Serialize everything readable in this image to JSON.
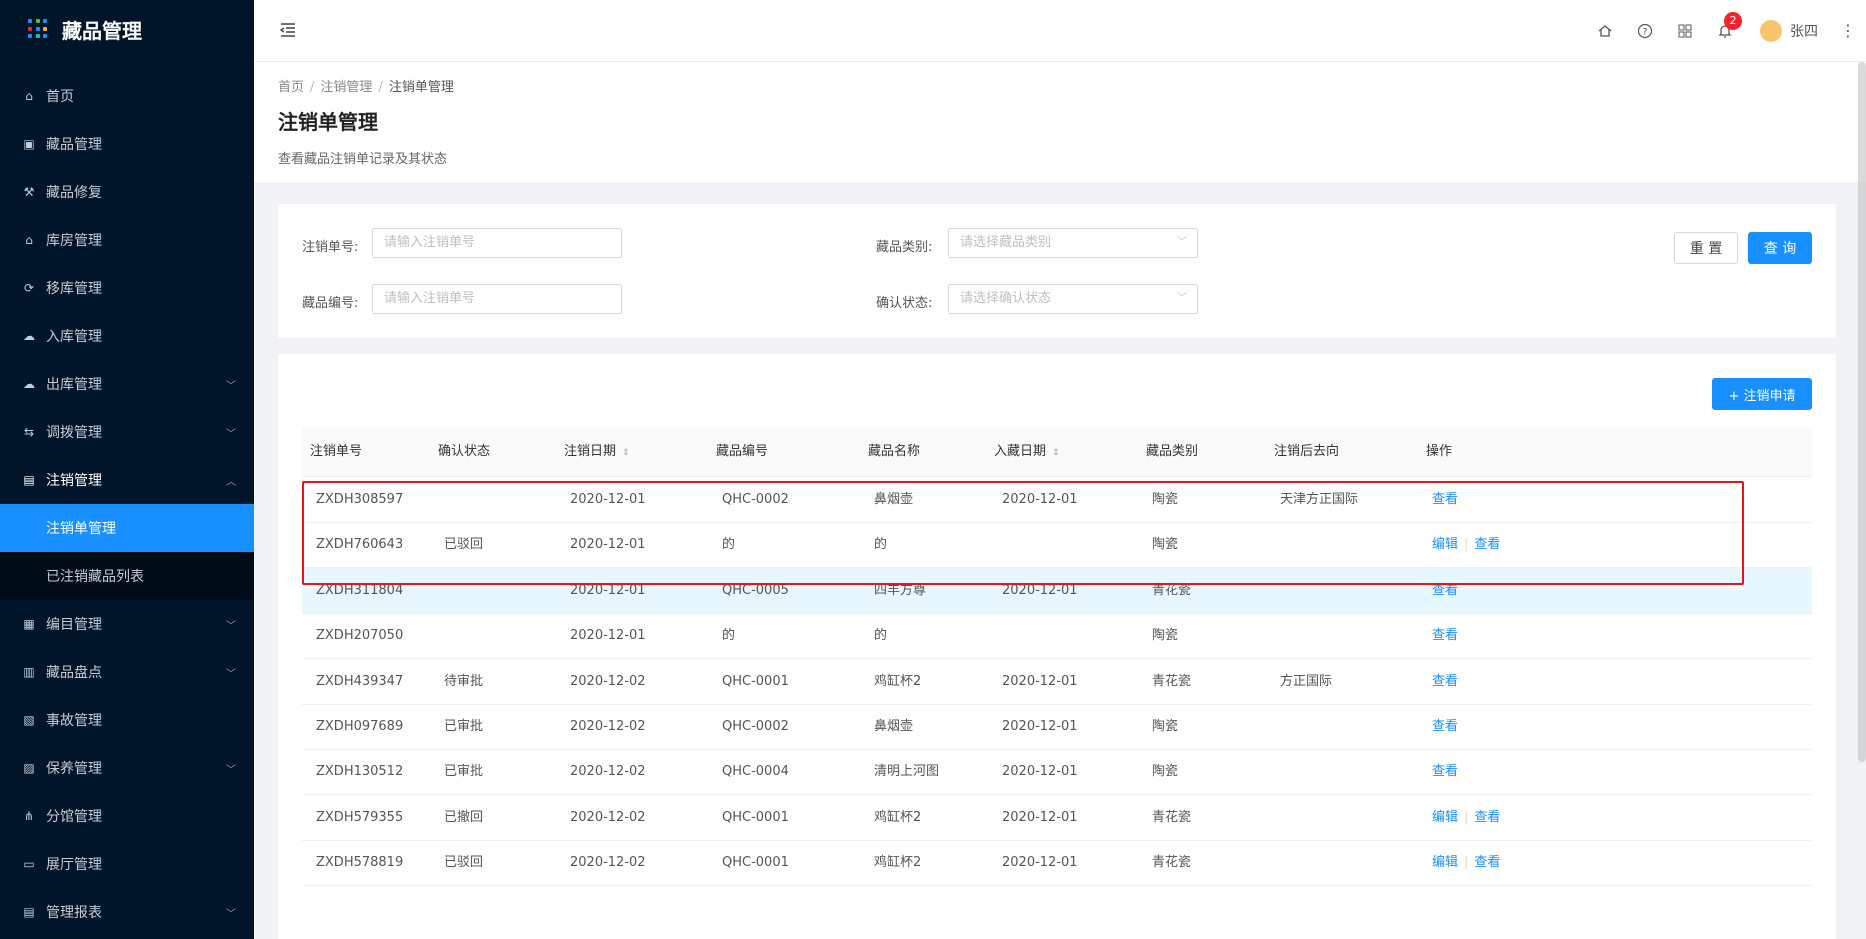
{
  "app": {
    "title": "藏品管理"
  },
  "sidebar": {
    "items": [
      {
        "label": "首页",
        "icon": "home-icon"
      },
      {
        "label": "藏品管理",
        "icon": "calendar-icon"
      },
      {
        "label": "藏品修复",
        "icon": "wrench-icon"
      },
      {
        "label": "库房管理",
        "icon": "warehouse-icon"
      },
      {
        "label": "移库管理",
        "icon": "move-icon"
      },
      {
        "label": "入库管理",
        "icon": "cloud-upload-icon"
      },
      {
        "label": "出库管理",
        "icon": "cloud-download-icon",
        "expandable": true
      },
      {
        "label": "调拨管理",
        "icon": "transfer-icon",
        "expandable": true
      },
      {
        "label": "注销管理",
        "icon": "document-icon",
        "expandable": true,
        "open": true
      },
      {
        "label": "编目管理",
        "icon": "catalog-icon",
        "expandable": true
      },
      {
        "label": "藏品盘点",
        "icon": "inventory-icon",
        "expandable": true
      },
      {
        "label": "事故管理",
        "icon": "incident-icon"
      },
      {
        "label": "保养管理",
        "icon": "maintenance-icon",
        "expandable": true
      },
      {
        "label": "分馆管理",
        "icon": "branch-icon"
      },
      {
        "label": "展厅管理",
        "icon": "hall-icon"
      },
      {
        "label": "管理报表",
        "icon": "report-icon",
        "expandable": true
      }
    ],
    "submenu": [
      {
        "label": "注销单管理",
        "active": true
      },
      {
        "label": "已注销藏品列表",
        "active": false
      }
    ]
  },
  "topbar": {
    "notification_count": "2",
    "user_name": "张四"
  },
  "breadcrumb": [
    "首页",
    "注销管理",
    "注销单管理"
  ],
  "page": {
    "title": "注销单管理",
    "description": "查看藏品注销单记录及其状态"
  },
  "filters": {
    "order_no_label": "注销单号:",
    "order_no_placeholder": "请输入注销单号",
    "item_no_label": "藏品编号:",
    "item_no_placeholder": "请输入注销单号",
    "category_label": "藏品类别:",
    "category_placeholder": "请选择藏品类别",
    "status_label": "确认状态:",
    "status_placeholder": "请选择确认状态",
    "reset_label": "重 置",
    "search_label": "查 询"
  },
  "table": {
    "add_button": "+ 注销申请",
    "columns": [
      "注销单号",
      "确认状态",
      "注销日期",
      "藏品编号",
      "藏品名称",
      "入藏日期",
      "藏品类别",
      "注销后去向",
      "操作"
    ],
    "rows": [
      {
        "no": "ZXDH308597",
        "status": "",
        "date": "2020-12-01",
        "item_no": "QHC-0002",
        "name": "鼻烟壶",
        "in_date": "2020-12-01",
        "category": "陶瓷",
        "dest": "天津方正国际",
        "actions": [
          "查看"
        ]
      },
      {
        "no": "ZXDH760643",
        "status": "已驳回",
        "date": "2020-12-01",
        "item_no": "的",
        "name": "的",
        "in_date": "",
        "category": "陶瓷",
        "dest": "",
        "actions": [
          "编辑",
          "查看"
        ]
      },
      {
        "no": "ZXDH311804",
        "status": "",
        "date": "2020-12-01",
        "item_no": "QHC-0005",
        "name": "四羊方尊",
        "in_date": "2020-12-01",
        "category": "青花瓷",
        "dest": "",
        "actions": [
          "查看"
        ],
        "highlight": true
      },
      {
        "no": "ZXDH207050",
        "status": "",
        "date": "2020-12-01",
        "item_no": "的",
        "name": "的",
        "in_date": "",
        "category": "陶瓷",
        "dest": "",
        "actions": [
          "查看"
        ]
      },
      {
        "no": "ZXDH439347",
        "status": "待审批",
        "date": "2020-12-02",
        "item_no": "QHC-0001",
        "name": "鸡缸杯2",
        "in_date": "2020-12-01",
        "category": "青花瓷",
        "dest": "方正国际",
        "actions": [
          "查看"
        ]
      },
      {
        "no": "ZXDH097689",
        "status": "已审批",
        "date": "2020-12-02",
        "item_no": "QHC-0002",
        "name": "鼻烟壶",
        "in_date": "2020-12-01",
        "category": "陶瓷",
        "dest": "",
        "actions": [
          "查看"
        ]
      },
      {
        "no": "ZXDH130512",
        "status": "已审批",
        "date": "2020-12-02",
        "item_no": "QHC-0004",
        "name": "清明上河图",
        "in_date": "2020-12-01",
        "category": "陶瓷",
        "dest": "",
        "actions": [
          "查看"
        ]
      },
      {
        "no": "ZXDH579355",
        "status": "已撤回",
        "date": "2020-12-02",
        "item_no": "QHC-0001",
        "name": "鸡缸杯2",
        "in_date": "2020-12-01",
        "category": "青花瓷",
        "dest": "",
        "actions": [
          "编辑",
          "查看"
        ]
      },
      {
        "no": "ZXDH578819",
        "status": "已驳回",
        "date": "2020-12-02",
        "item_no": "QHC-0001",
        "name": "鸡缸杯2",
        "in_date": "2020-12-01",
        "category": "青花瓷",
        "dest": "",
        "actions": [
          "编辑",
          "查看"
        ]
      }
    ]
  },
  "colors": {
    "primary": "#1890ff",
    "sidebar_bg": "#001529",
    "highlight_box": "#e8141b"
  }
}
